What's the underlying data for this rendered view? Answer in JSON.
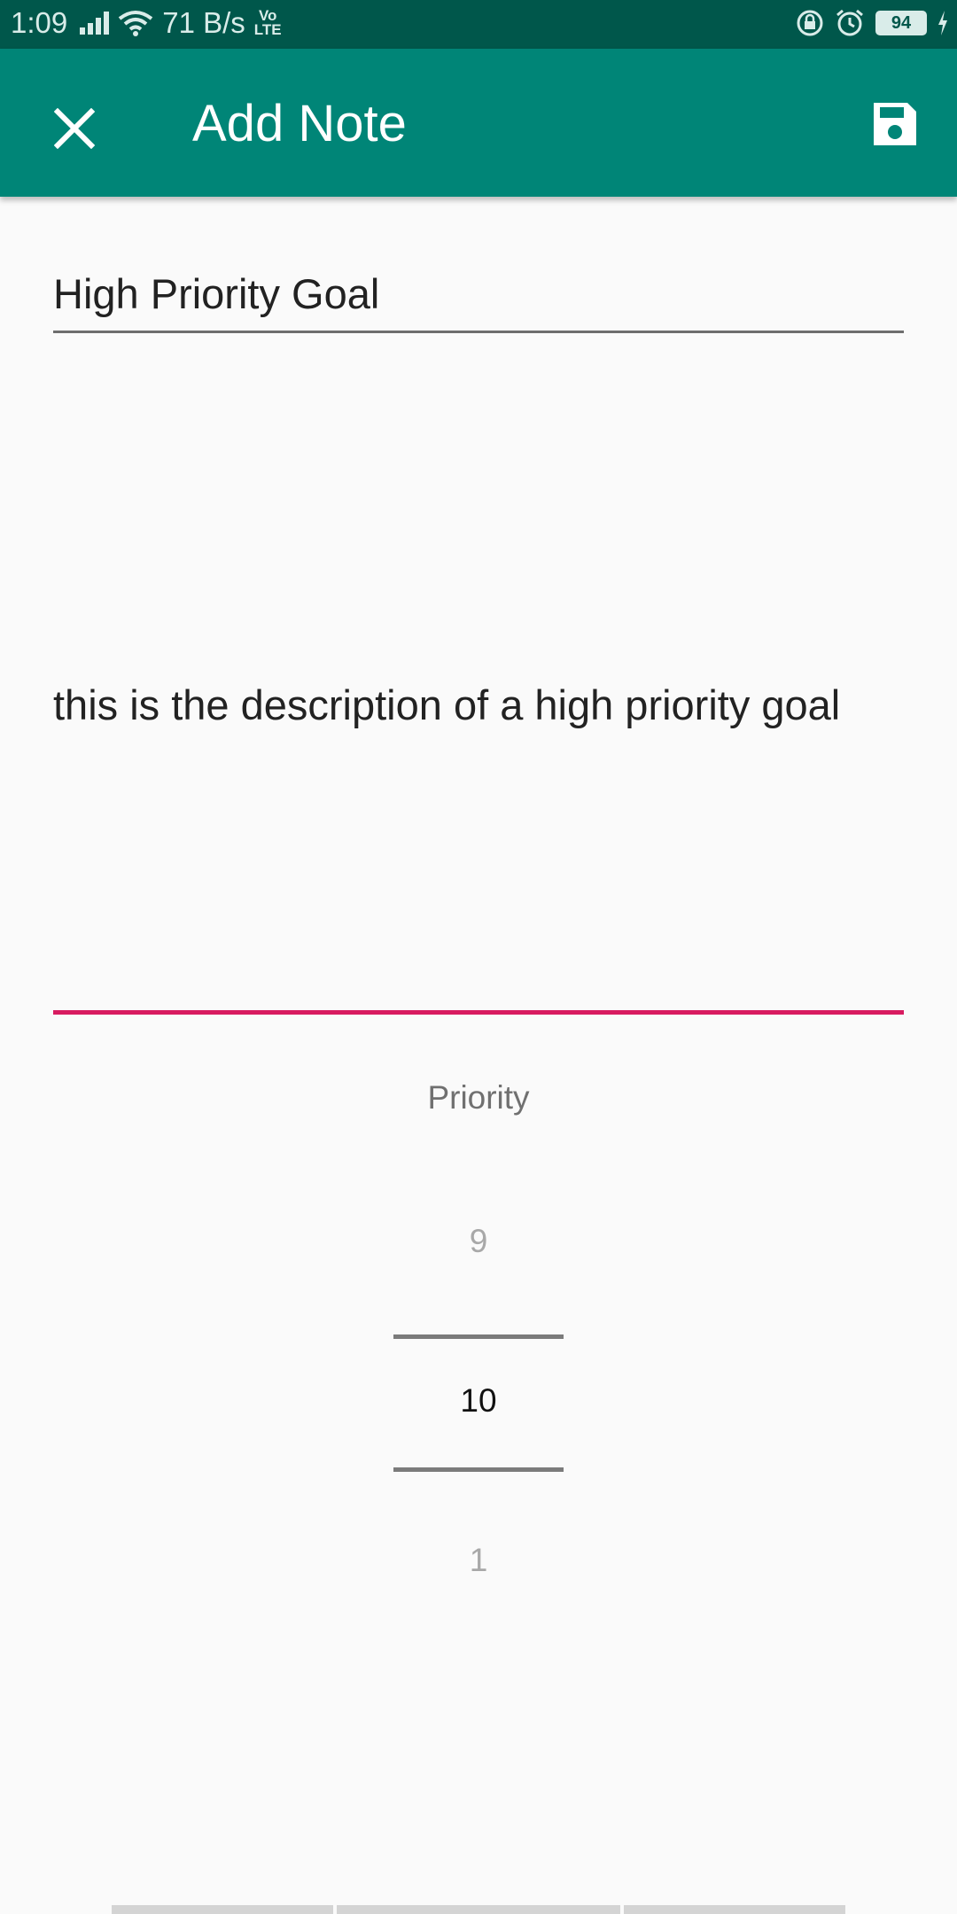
{
  "status_bar": {
    "time": "1:09",
    "network_speed": "71 B/s",
    "volte_top": "Vo",
    "volte_bottom": "LTE",
    "battery": "94"
  },
  "app_bar": {
    "title": "Add Note",
    "close_icon": "close-icon",
    "save_icon": "save-icon",
    "color": "#008577"
  },
  "form": {
    "title_value": "High Priority Goal",
    "description_value": "this is the description of a high priority goal",
    "accent_color": "#d81b60"
  },
  "priority_picker": {
    "label": "Priority",
    "previous": "9",
    "current": "10",
    "next": "1"
  }
}
